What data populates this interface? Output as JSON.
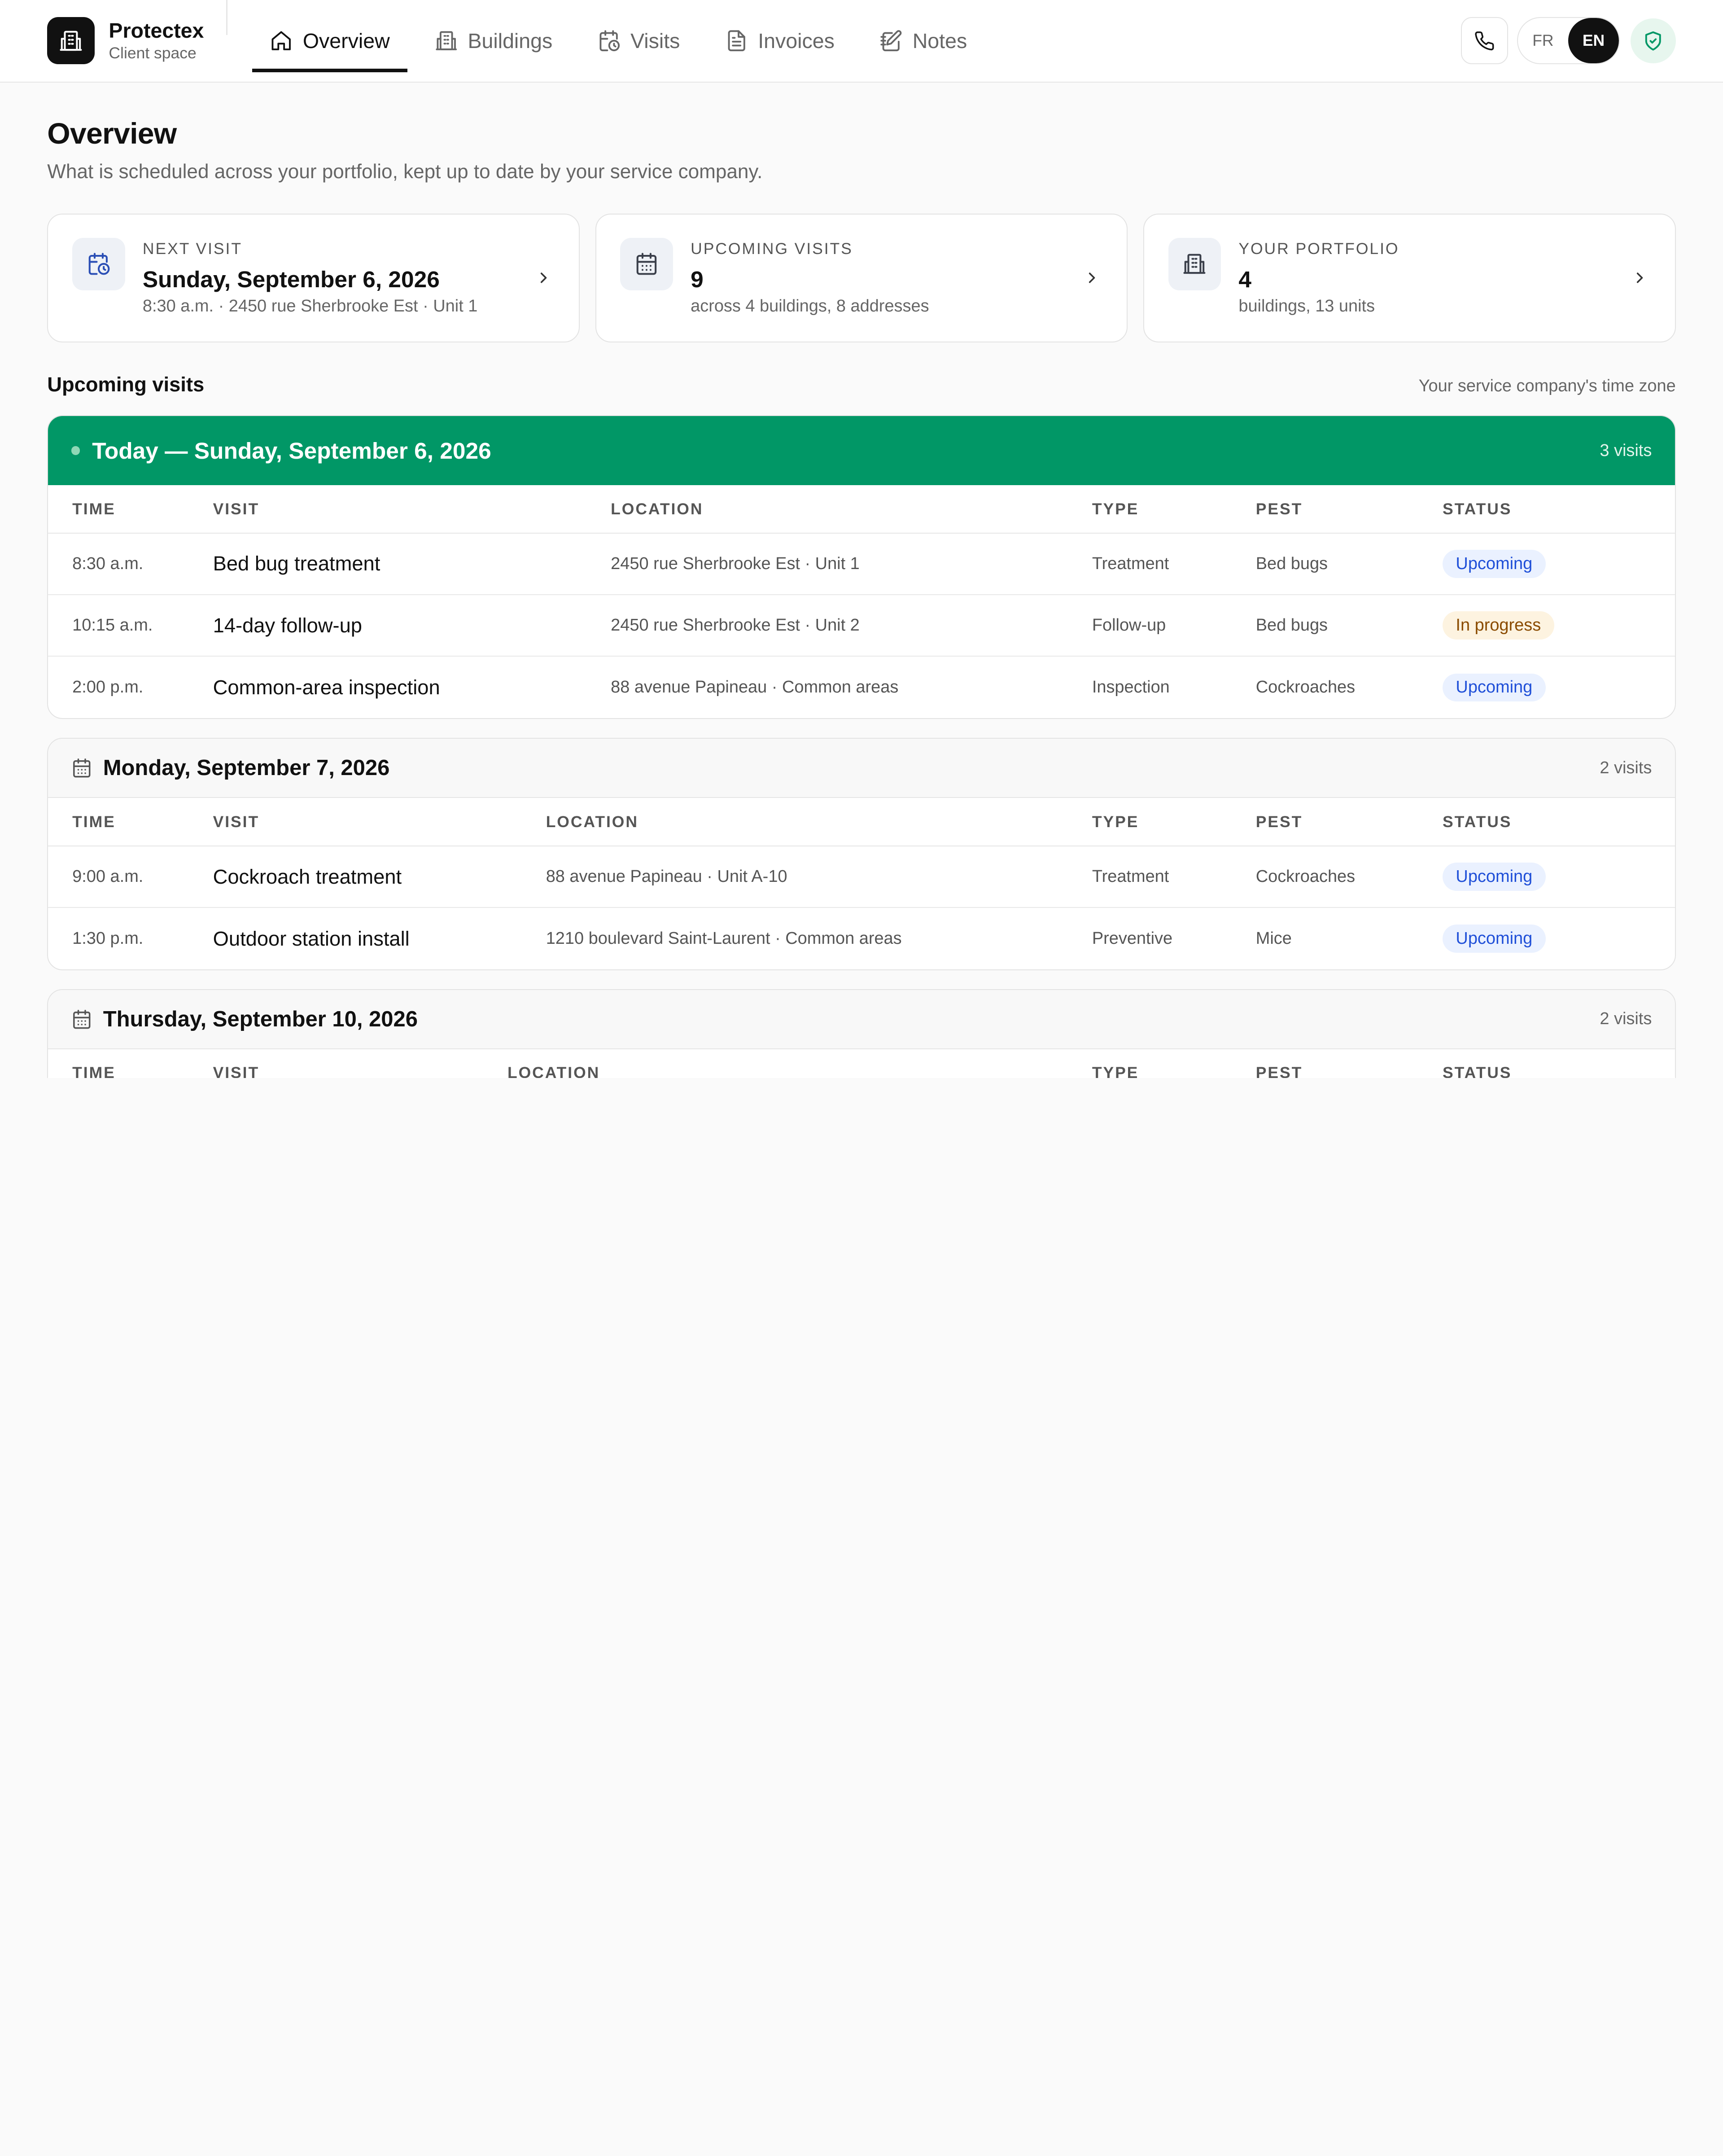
{
  "brand": {
    "name": "Protectex",
    "subtitle": "Client space"
  },
  "nav": {
    "tabs": [
      {
        "label": "Overview",
        "icon": "home-icon",
        "active": true
      },
      {
        "label": "Buildings",
        "icon": "building-icon"
      },
      {
        "label": "Visits",
        "icon": "calendar-clock-icon"
      },
      {
        "label": "Invoices",
        "icon": "document-icon"
      },
      {
        "label": "Notes",
        "icon": "notebook-icon"
      }
    ]
  },
  "header_actions": {
    "phone_icon": "phone-icon",
    "languages": [
      "FR",
      "EN"
    ],
    "active_language": "EN",
    "shield_icon": "shield-check-icon"
  },
  "page": {
    "title": "Overview",
    "subtitle": "What is scheduled across your portfolio, kept up to date by your service company."
  },
  "summary_cards": [
    {
      "label": "NEXT VISIT",
      "value": "Sunday, September 6, 2026",
      "detail": "8:30 a.m. · 2450 rue Sherbrooke Est · Unit 1",
      "icon": "calendar-clock-icon"
    },
    {
      "label": "UPCOMING VISITS",
      "value": "9",
      "detail": "across 4 buildings, 8 addresses",
      "icon": "calendar-icon"
    },
    {
      "label": "YOUR PORTFOLIO",
      "value": "4",
      "detail": "buildings, 13 units",
      "icon": "building-icon"
    }
  ],
  "upcoming": {
    "title": "Upcoming visits",
    "note": "Your service company's time zone",
    "columns": {
      "time": "TIME",
      "visit": "VISIT",
      "location": "LOCATION",
      "type": "TYPE",
      "pest": "PEST",
      "status": "STATUS"
    },
    "days": [
      {
        "title": "Today — Sunday, September 6, 2026",
        "count": "3 visits",
        "rows": [
          {
            "time": "8:30 a.m.",
            "visit": "Bed bug treatment",
            "location": "2450 rue Sherbrooke Est · Unit 1",
            "type": "Treatment",
            "pest": "Bed bugs",
            "status": "Upcoming"
          },
          {
            "time": "10:15 a.m.",
            "visit": "14-day follow-up",
            "location": "2450 rue Sherbrooke Est · Unit 2",
            "type": "Follow-up",
            "pest": "Bed bugs",
            "status": "In progress"
          },
          {
            "time": "2:00 p.m.",
            "visit": "Common-area inspection",
            "location": "88 avenue Papineau · Common areas",
            "type": "Inspection",
            "pest": "Cockroaches",
            "status": "Upcoming"
          }
        ]
      },
      {
        "title": "Monday, September 7, 2026",
        "count": "2 visits",
        "rows": [
          {
            "time": "9:00 a.m.",
            "visit": "Cockroach treatment",
            "location": "88 avenue Papineau · Unit A-10",
            "type": "Treatment",
            "pest": "Cockroaches",
            "status": "Upcoming"
          },
          {
            "time": "1:30 p.m.",
            "visit": "Outdoor station install",
            "location": "1210 boulevard Saint-Laurent · Common areas",
            "type": "Preventive",
            "pest": "Mice",
            "status": "Upcoming"
          }
        ]
      },
      {
        "title": "Thursday, September 10, 2026",
        "count": "2 visits",
        "rows": []
      }
    ]
  },
  "colors": {
    "today_header": "#019766",
    "upcoming_badge": "#1f4fd8",
    "progress_badge": "#8a4b00"
  }
}
